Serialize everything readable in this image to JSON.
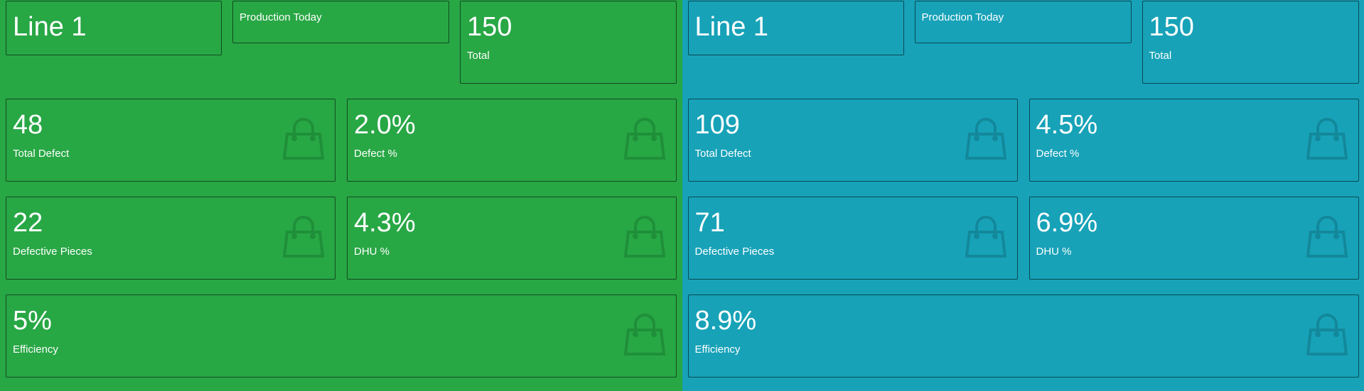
{
  "colors": {
    "green_panel": "#28a745",
    "teal_panel": "#17a2b8",
    "text": "#ffffff"
  },
  "panels": [
    {
      "line": "Line 1",
      "production_label": "Production Today",
      "total_value": "150",
      "total_label": "Total",
      "total_defect_value": "48",
      "total_defect_label": "Total Defect",
      "defect_pct_value": "2.0%",
      "defect_pct_label": "Defect %",
      "defective_pieces_value": "22",
      "defective_pieces_label": "Defective Pieces",
      "dhu_value": "4.3%",
      "dhu_label": "DHU %",
      "efficiency_value": "5%",
      "efficiency_label": "Efficiency",
      "icon": "shopping-bag-icon"
    },
    {
      "line": "Line 1",
      "production_label": "Production Today",
      "total_value": "150",
      "total_label": "Total",
      "total_defect_value": "109",
      "total_defect_label": "Total Defect",
      "defect_pct_value": "4.5%",
      "defect_pct_label": "Defect %",
      "defective_pieces_value": "71",
      "defective_pieces_label": "Defective Pieces",
      "dhu_value": "6.9%",
      "dhu_label": "DHU %",
      "efficiency_value": "8.9%",
      "efficiency_label": "Efficiency",
      "icon": "shopping-bag-icon"
    }
  ]
}
